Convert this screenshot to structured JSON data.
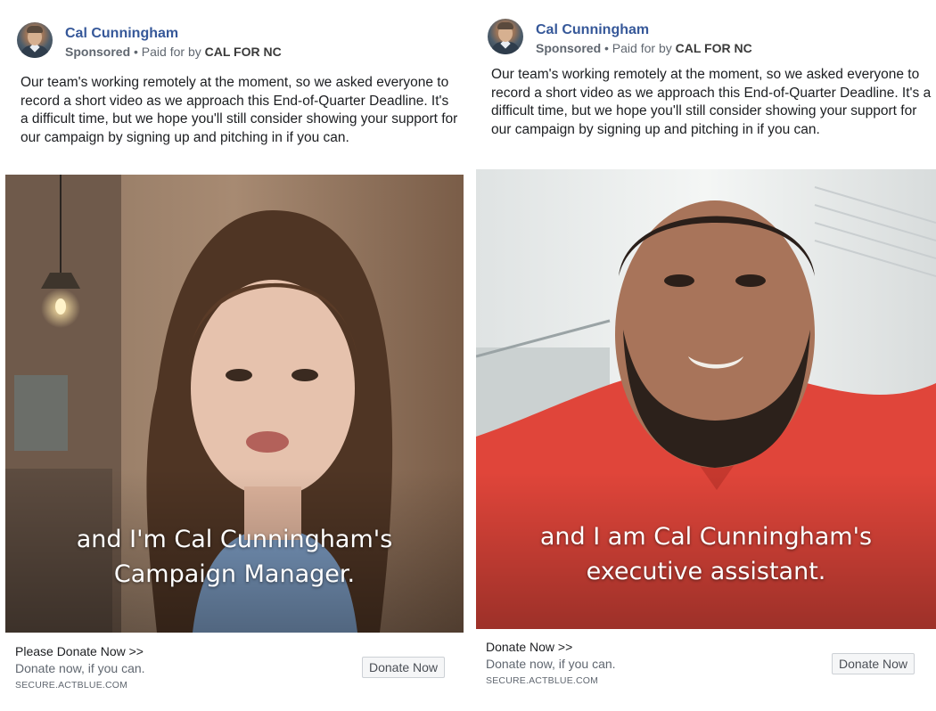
{
  "ads": [
    {
      "page_name": "Cal Cunningham",
      "sponsored_label": "Sponsored",
      "paid_for_prefix": " • Paid for by ",
      "payer": "CAL FOR NC",
      "body": "Our team's working remotely at the moment, so we asked everyone to record a short video as we approach this End-of-Quarter Deadline. It's a difficult time, but we hope you'll still consider showing your support for our campaign by signing up and pitching in if you can.",
      "caption_line1": "and I'm Cal Cunningham's",
      "caption_line2": "Campaign Manager.",
      "link_title": "Please Donate Now >>",
      "link_description": "Donate now, if you can.",
      "link_domain": "SECURE.ACTBLUE.COM",
      "cta_label": "Donate Now"
    },
    {
      "page_name": "Cal Cunningham",
      "sponsored_label": "Sponsored",
      "paid_for_prefix": " • Paid for by ",
      "payer": "CAL FOR NC",
      "body": "Our team's working remotely at the moment, so we asked everyone to record a short video as we approach this End-of-Quarter Deadline. It's a difficult time, but we hope you'll still consider showing your support for our campaign by signing up and pitching in if you can.",
      "caption_line1": "and I am Cal Cunningham's",
      "caption_line2": "executive assistant.",
      "link_title": "Donate Now >>",
      "link_description": "Donate now, if you can.",
      "link_domain": "SECURE.ACTBLUE.COM",
      "cta_label": "Donate Now"
    }
  ]
}
